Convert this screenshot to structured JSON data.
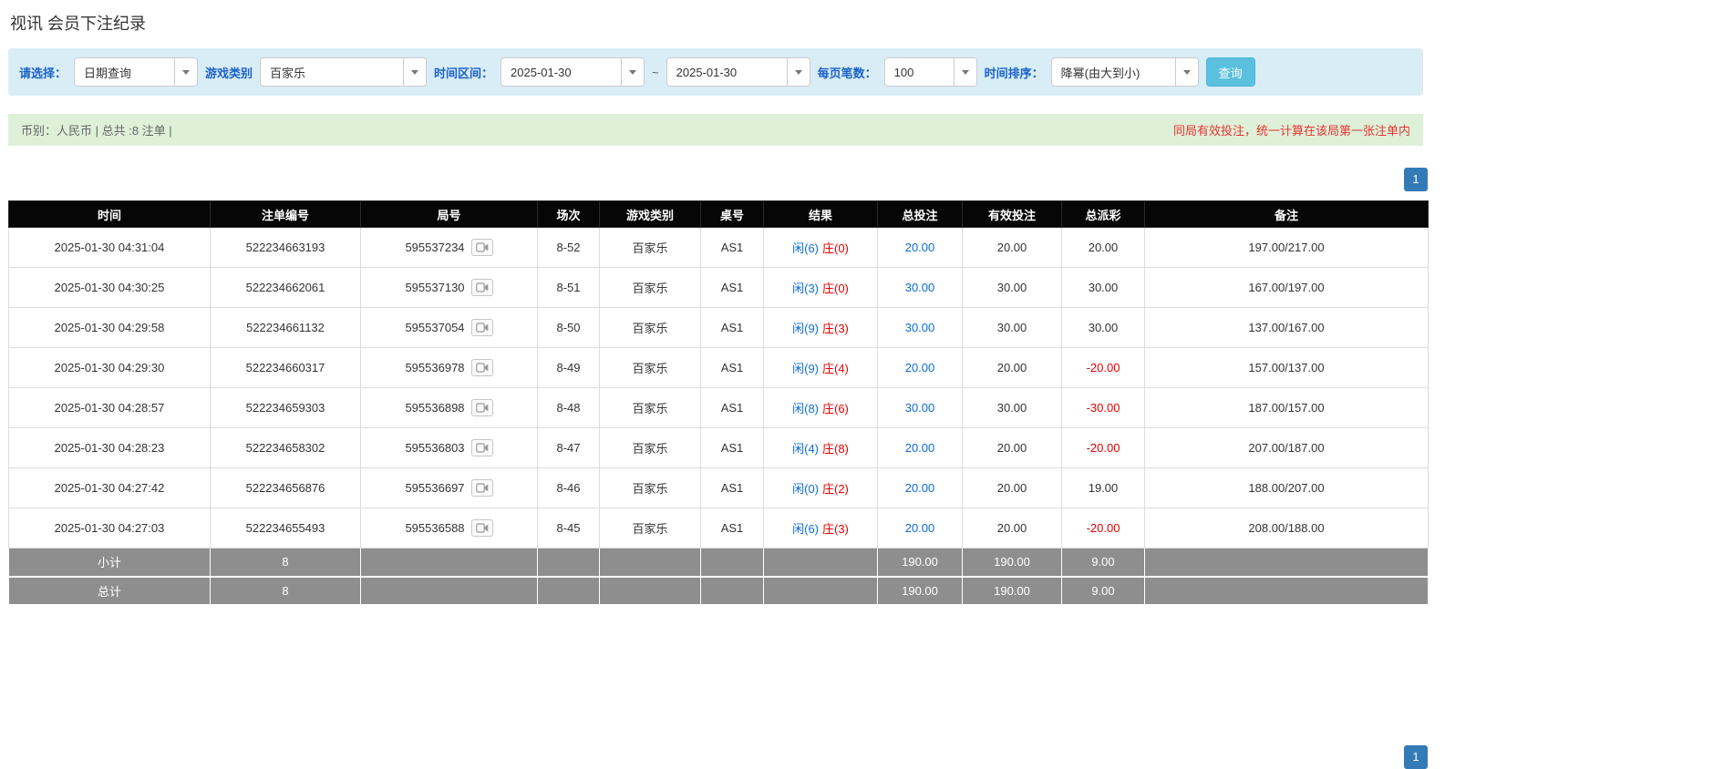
{
  "colors": {
    "filter-bg": "#d9edf7",
    "label-blue": "#1a62c9",
    "btn-info-bg": "#5bc0de",
    "btn-info-border": "#46b8da",
    "summary-bg": "#dff0d8",
    "summary-text": "#666666",
    "notice-red": "#e53333",
    "pagination-blue": "#337ab7",
    "header-bg": "#060606",
    "footer-bg": "#8e8e8e",
    "link-blue": "#0a6cd6",
    "result-player-blue": "#0a6cd6",
    "result-banker-red": "#e60000",
    "negative-red": "#e60000"
  },
  "page": {
    "title": "视讯 会员下注纪录"
  },
  "filters": {
    "select_label": "请选择：",
    "select_value": "日期查询",
    "game_label": "游戏类别",
    "game_value": "百家乐",
    "range_label": "时间区间：",
    "date_from": "2025-01-30",
    "range_separator": "~",
    "date_to": "2025-01-30",
    "per_page_label": "每页笔数：",
    "per_page_value": "100",
    "sort_label": "时间排序：",
    "sort_value": "降幂(由大到小)",
    "search_button": "查询"
  },
  "summary": {
    "left": "币别：人民币 | 总共 :8 注单 |",
    "right": "同局有效投注，统一计算在该局第一张注单内"
  },
  "pagination": {
    "page": "1"
  },
  "table": {
    "headers": [
      "时间",
      "注单编号",
      "局号",
      "场次",
      "游戏类别",
      "桌号",
      "结果",
      "总投注",
      "有效投注",
      "总派彩",
      "备注"
    ],
    "rows": [
      {
        "time": "2025-01-30 04:31:04",
        "bet_id": "522234663193",
        "round_id": "595537234",
        "session": "8-52",
        "game": "百家乐",
        "table_no": "AS1",
        "result_player": "闲(6)",
        "result_banker": "庄(0)",
        "total_bet": "20.00",
        "valid_bet": "20.00",
        "payout": "20.00",
        "note": "197.00/217.00"
      },
      {
        "time": "2025-01-30 04:30:25",
        "bet_id": "522234662061",
        "round_id": "595537130",
        "session": "8-51",
        "game": "百家乐",
        "table_no": "AS1",
        "result_player": "闲(3)",
        "result_banker": "庄(0)",
        "total_bet": "30.00",
        "valid_bet": "30.00",
        "payout": "30.00",
        "note": "167.00/197.00"
      },
      {
        "time": "2025-01-30 04:29:58",
        "bet_id": "522234661132",
        "round_id": "595537054",
        "session": "8-50",
        "game": "百家乐",
        "table_no": "AS1",
        "result_player": "闲(9)",
        "result_banker": "庄(3)",
        "total_bet": "30.00",
        "valid_bet": "30.00",
        "payout": "30.00",
        "note": "137.00/167.00"
      },
      {
        "time": "2025-01-30 04:29:30",
        "bet_id": "522234660317",
        "round_id": "595536978",
        "session": "8-49",
        "game": "百家乐",
        "table_no": "AS1",
        "result_player": "闲(9)",
        "result_banker": "庄(4)",
        "total_bet": "20.00",
        "valid_bet": "20.00",
        "payout": "-20.00",
        "note": "157.00/137.00"
      },
      {
        "time": "2025-01-30 04:28:57",
        "bet_id": "522234659303",
        "round_id": "595536898",
        "session": "8-48",
        "game": "百家乐",
        "table_no": "AS1",
        "result_player": "闲(8)",
        "result_banker": "庄(6)",
        "total_bet": "30.00",
        "valid_bet": "30.00",
        "payout": "-30.00",
        "note": "187.00/157.00"
      },
      {
        "time": "2025-01-30 04:28:23",
        "bet_id": "522234658302",
        "round_id": "595536803",
        "session": "8-47",
        "game": "百家乐",
        "table_no": "AS1",
        "result_player": "闲(4)",
        "result_banker": "庄(8)",
        "total_bet": "20.00",
        "valid_bet": "20.00",
        "payout": "-20.00",
        "note": "207.00/187.00"
      },
      {
        "time": "2025-01-30 04:27:42",
        "bet_id": "522234656876",
        "round_id": "595536697",
        "session": "8-46",
        "game": "百家乐",
        "table_no": "AS1",
        "result_player": "闲(0)",
        "result_banker": "庄(2)",
        "total_bet": "20.00",
        "valid_bet": "20.00",
        "payout": "19.00",
        "note": "188.00/207.00"
      },
      {
        "time": "2025-01-30 04:27:03",
        "bet_id": "522234655493",
        "round_id": "595536588",
        "session": "8-45",
        "game": "百家乐",
        "table_no": "AS1",
        "result_player": "闲(6)",
        "result_banker": "庄(3)",
        "total_bet": "20.00",
        "valid_bet": "20.00",
        "payout": "-20.00",
        "note": "208.00/188.00"
      }
    ],
    "subtotal": {
      "label": "小计",
      "count": "8",
      "total_bet": "190.00",
      "valid_bet": "190.00",
      "payout": "9.00"
    },
    "total": {
      "label": "总计",
      "count": "8",
      "total_bet": "190.00",
      "valid_bet": "190.00",
      "payout": "9.00"
    }
  }
}
